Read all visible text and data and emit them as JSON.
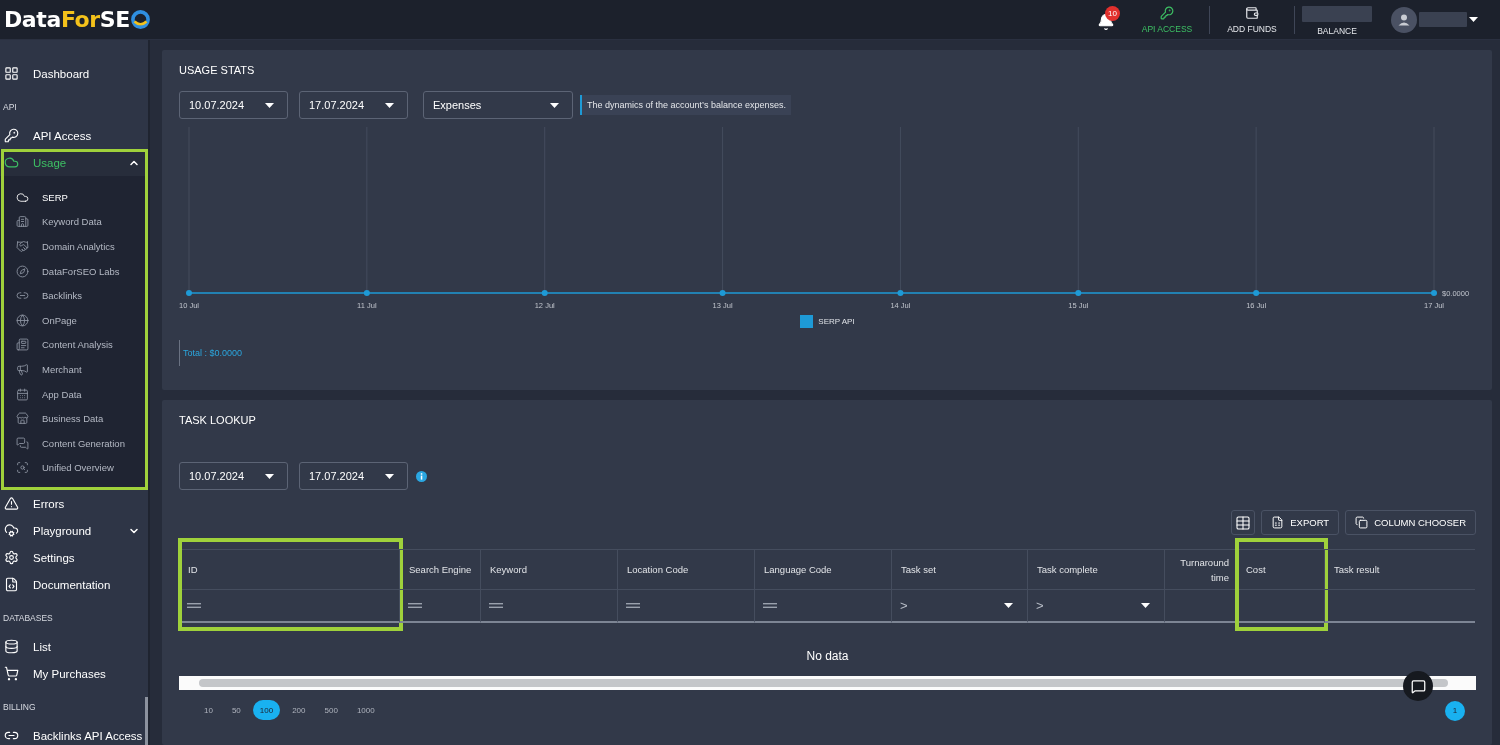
{
  "header": {
    "logo": {
      "parts": [
        {
          "text": "Data",
          "accent": false
        },
        {
          "text": "For",
          "accent": true
        },
        {
          "text": "SE",
          "accent": false
        }
      ]
    },
    "notifications": {
      "count": "10"
    },
    "nav": [
      {
        "kind": "link",
        "label": "API ACCESS",
        "selected": true
      },
      {
        "kind": "link",
        "label": "ADD FUNDS",
        "selected": false
      },
      {
        "kind": "balance",
        "label": "BALANCE",
        "selected": false
      }
    ]
  },
  "sidebar": {
    "items": [
      {
        "kind": "link",
        "label": "Dashboard",
        "selected": false
      },
      {
        "kind": "heading",
        "label": "API"
      },
      {
        "kind": "link",
        "label": "API Access",
        "selected": false
      },
      {
        "kind": "group",
        "label": "Usage",
        "selected": true,
        "expanded": true,
        "highlighted": true,
        "children": [
          {
            "label": "SERP",
            "selected": true
          },
          {
            "label": "Keyword Data",
            "selected": false
          },
          {
            "label": "Domain Analytics",
            "selected": false
          },
          {
            "label": "DataForSEO Labs",
            "selected": false
          },
          {
            "label": "Backlinks",
            "selected": false
          },
          {
            "label": "OnPage",
            "selected": false
          },
          {
            "label": "Content Analysis",
            "selected": false
          },
          {
            "label": "Merchant",
            "selected": false
          },
          {
            "label": "App Data",
            "selected": false
          },
          {
            "label": "Business Data",
            "selected": false
          },
          {
            "label": "Content Generation",
            "selected": false
          },
          {
            "label": "Unified Overview",
            "selected": false
          }
        ]
      },
      {
        "kind": "link",
        "label": "Errors",
        "selected": false
      },
      {
        "kind": "group",
        "label": "Playground",
        "selected": false,
        "expanded": false,
        "highlighted": false
      },
      {
        "kind": "link",
        "label": "Settings",
        "selected": false
      },
      {
        "kind": "link",
        "label": "Documentation",
        "selected": false
      },
      {
        "kind": "heading",
        "label": "DATABASES"
      },
      {
        "kind": "link",
        "label": "List",
        "selected": false
      },
      {
        "kind": "link",
        "label": "My Purchases",
        "selected": false
      },
      {
        "kind": "heading",
        "label": "BILLING"
      },
      {
        "kind": "link",
        "label": "Backlinks API Access",
        "selected": false
      }
    ]
  },
  "usage_stats": {
    "title": "USAGE STATS",
    "filters": [
      {
        "kind": "date",
        "value": "10.07.2024"
      },
      {
        "kind": "date",
        "value": "17.07.2024"
      },
      {
        "kind": "select",
        "value": "Expenses"
      }
    ],
    "note": "The dynamics of the account’s balance expenses.",
    "chart": {
      "x_labels": [
        "10 Jul",
        "11 Jul",
        "12 Jul",
        "13 Jul",
        "14 Jul",
        "15 Jul",
        "16 Jul",
        "17 Jul"
      ],
      "end_label": "$0.0000",
      "legend": [
        {
          "label": "SERP API",
          "color": "#1e9ad6"
        }
      ]
    },
    "total": "Total : $0.0000"
  },
  "task_lookup": {
    "title": "TASK LOOKUP",
    "filters": [
      {
        "value": "10.07.2024"
      },
      {
        "value": "17.07.2024"
      }
    ],
    "toolbar": [
      {
        "label": "EXPORT"
      },
      {
        "label": "COLUMN CHOOSER"
      }
    ],
    "table": {
      "columns": [
        {
          "kind": "text",
          "label": "ID",
          "highlighted": true,
          "filter": {
            "kind": "equals"
          }
        },
        {
          "kind": "text",
          "label": "Search Engine",
          "highlighted": false,
          "filter": {
            "kind": "equals"
          }
        },
        {
          "kind": "text",
          "label": "Keyword",
          "highlighted": false,
          "filter": {
            "kind": "equals"
          }
        },
        {
          "kind": "text",
          "label": "Location Code",
          "highlighted": false,
          "filter": {
            "kind": "equals"
          }
        },
        {
          "kind": "text",
          "label": "Language Code",
          "highlighted": false,
          "filter": {
            "kind": "equals"
          }
        },
        {
          "kind": "text",
          "label": "Task set",
          "highlighted": false,
          "filter": {
            "kind": "select",
            "operator": ">"
          }
        },
        {
          "kind": "text",
          "label": "Task complete",
          "highlighted": false,
          "filter": {
            "kind": "select",
            "operator": ">"
          }
        },
        {
          "kind": "numeric",
          "label": "Turnaround time",
          "highlighted": false
        },
        {
          "kind": "text",
          "label": "Cost",
          "highlighted": true
        },
        {
          "kind": "text",
          "label": "Task result",
          "highlighted": false
        }
      ],
      "empty_text": "No data"
    },
    "page_sizes": [
      {
        "label": "10",
        "selected": false
      },
      {
        "label": "50",
        "selected": false
      },
      {
        "label": "100",
        "selected": true
      },
      {
        "label": "200",
        "selected": false
      },
      {
        "label": "500",
        "selected": false
      },
      {
        "label": "1000",
        "selected": false
      }
    ],
    "pages": [
      {
        "label": "1",
        "selected": true
      }
    ]
  }
}
